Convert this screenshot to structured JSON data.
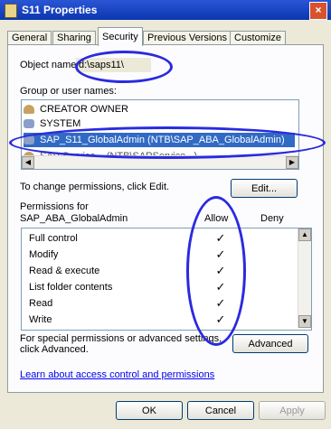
{
  "window": {
    "title": "S11 Properties",
    "close": "×"
  },
  "tabs": [
    "General",
    "Sharing",
    "Security",
    "Previous Versions",
    "Customize"
  ],
  "object_name": {
    "label": "Object name:",
    "value": "d:\\saps11\\"
  },
  "group_names": {
    "label": "Group or user names:",
    "items": [
      "CREATOR OWNER",
      "SYSTEM",
      "SAP_S11_GlobalAdmin (NTB\\SAP_ABA_GlobalAdmin)",
      "SAP Service... (NTB\\SAPService...)"
    ]
  },
  "change_hint": "To change permissions, click Edit.",
  "edit_button": "Edit...",
  "permissions": {
    "label_line1": "Permissions for",
    "label_line2": "SAP_ABA_GlobalAdmin",
    "allow_label": "Allow",
    "deny_label": "Deny",
    "rows": [
      {
        "name": "Full control",
        "allow": "✓"
      },
      {
        "name": "Modify",
        "allow": "✓"
      },
      {
        "name": "Read & execute",
        "allow": "✓"
      },
      {
        "name": "List folder contents",
        "allow": "✓"
      },
      {
        "name": "Read",
        "allow": "✓"
      },
      {
        "name": "Write",
        "allow": "✓"
      }
    ]
  },
  "special_hint_line1": "For special permissions or advanced settings,",
  "special_hint_line2": "click Advanced.",
  "advanced_button": "Advanced",
  "learn_link": "Learn about access control and permissions",
  "footer": {
    "ok": "OK",
    "cancel": "Cancel",
    "apply": "Apply"
  },
  "colors": {
    "titlebar": "#0A36B0",
    "selection": "#316AC5",
    "annotation": "#2A2AE0"
  }
}
